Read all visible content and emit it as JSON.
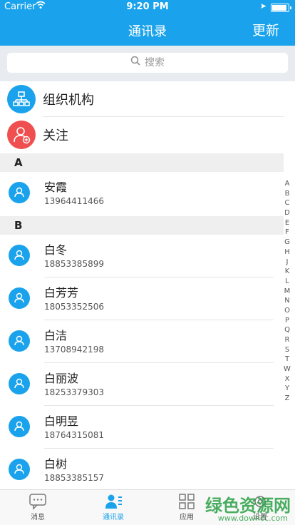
{
  "status": {
    "carrier": "Carrier",
    "time": "9:20 PM"
  },
  "nav": {
    "title": "通讯录",
    "refresh_label": "更新"
  },
  "search": {
    "placeholder": "搜索"
  },
  "fixed_items": [
    {
      "label": "组织机构",
      "color": "#1aa3ec",
      "icon": "org-chart-icon"
    },
    {
      "label": "关注",
      "color": "#f04f4f",
      "icon": "follow-user-icon"
    }
  ],
  "sections": [
    {
      "letter": "A",
      "contacts": [
        {
          "name": "安霞",
          "phone": "13964411466"
        }
      ]
    },
    {
      "letter": "B",
      "contacts": [
        {
          "name": "白冬",
          "phone": "18853385899"
        },
        {
          "name": "白芳芳",
          "phone": "18053352506"
        },
        {
          "name": "白洁",
          "phone": "13708942198"
        },
        {
          "name": "白丽波",
          "phone": "18253379303"
        },
        {
          "name": "白明昱",
          "phone": "18764315081"
        },
        {
          "name": "白树",
          "phone": "18853385157"
        }
      ]
    }
  ],
  "index_letters": [
    "A",
    "B",
    "C",
    "D",
    "E",
    "F",
    "G",
    "H",
    "J",
    "K",
    "L",
    "M",
    "N",
    "O",
    "P",
    "Q",
    "R",
    "S",
    "T",
    "W",
    "X",
    "Y",
    "Z"
  ],
  "tabs": [
    {
      "label": "消息",
      "icon": "message-icon"
    },
    {
      "label": "通讯录",
      "icon": "contacts-icon"
    },
    {
      "label": "应用",
      "icon": "apps-grid-icon"
    },
    {
      "label": "设置",
      "icon": "settings-icon"
    }
  ],
  "watermark": {
    "title": "绿色资源网",
    "url": "www.downcc.com"
  },
  "colors": {
    "primary": "#1aa3ec",
    "accent_red": "#f04f4f"
  }
}
